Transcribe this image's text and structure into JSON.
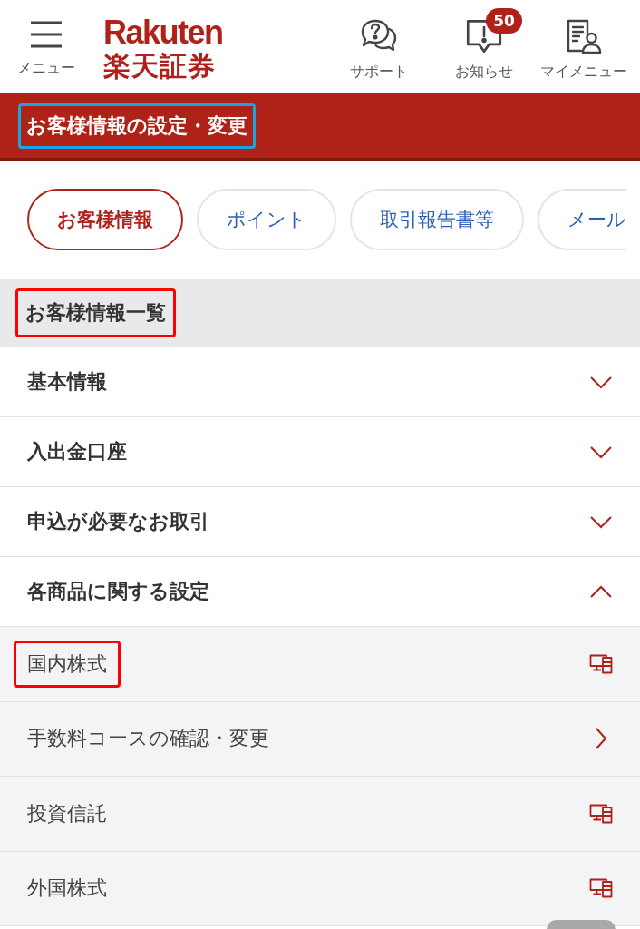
{
  "header": {
    "menu": {
      "label": "メニュー"
    },
    "logo": {
      "brand": "Rakuten",
      "name": "楽天証券"
    },
    "actions": [
      {
        "kind": "support",
        "label": "サポート"
      },
      {
        "kind": "notice",
        "label": "お知らせ",
        "badge": "50"
      },
      {
        "kind": "mymenu",
        "label": "マイメニュー"
      }
    ]
  },
  "page_title": {
    "text": "お客様情報の設定・変更",
    "highlight": {
      "color": "#19a4e6"
    }
  },
  "tabs": [
    {
      "label": "お客様情報",
      "selected": true
    },
    {
      "label": "ポイント",
      "selected": false
    },
    {
      "label": "取引報告書等",
      "selected": false
    },
    {
      "label": "メール",
      "selected": false
    }
  ],
  "section": {
    "title": "お客様情報一覧",
    "highlight": {
      "color": "#ff0000"
    }
  },
  "items": [
    {
      "label": "基本情報",
      "expanded": false
    },
    {
      "label": "入出金口座",
      "expanded": false
    },
    {
      "label": "申込が必要なお取引",
      "expanded": false
    },
    {
      "label": "各商品に関する設定",
      "expanded": true,
      "children": [
        {
          "label": "国内株式",
          "kind": "pc",
          "highlight": {
            "color": "#ff0000"
          }
        },
        {
          "label": "手数料コースの確認・変更",
          "kind": "link"
        },
        {
          "label": "投資信託",
          "kind": "pc"
        },
        {
          "label": "外国株式",
          "kind": "pc"
        }
      ]
    }
  ]
}
